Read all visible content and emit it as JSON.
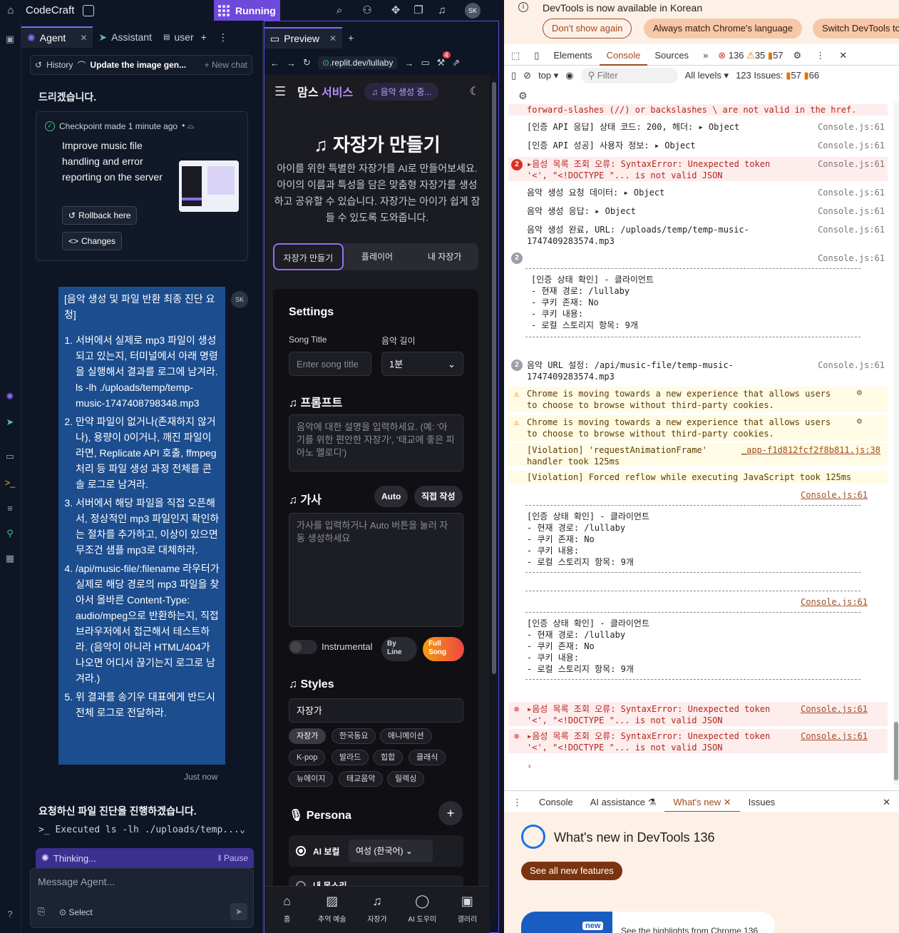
{
  "topbar": {
    "brand": "CodeCraft",
    "run_label": "Running",
    "avatar": "SK",
    "colors": {
      "run": "#6d4ad9"
    }
  },
  "agent": {
    "tabs": [
      {
        "label": "Agent"
      },
      {
        "label": "Assistant"
      },
      {
        "label": "user"
      }
    ],
    "history_label": "History",
    "current_chat": "Update the image gen...",
    "new_chat": "+ New chat",
    "cut_text": "드리겠습니다.",
    "checkpoint": {
      "header": "Checkpoint made 1 minute ago",
      "description": "Improve music file handling and error reporting on the server",
      "rollback": "Rollback here",
      "changes": "Changes"
    },
    "user_message": {
      "title": "[음악 생성 및 파일 반환 최종 진단 요청]",
      "items": [
        "서버에서 실제로 mp3 파일이 생성되고 있는지, 터미널에서 아래 명령을 실행해서 결과를 로그에 남겨라. ls -lh ./uploads/temp/temp-music-1747408798348.mp3",
        "만약 파일이 없거나(존재하지 않거나), 용량이 0이거나, 깨진 파일이라면, Replicate API 호출, ffmpeg 처리 등 파일 생성 과정 전체를 콘솔 로그로 남겨라.",
        "서버에서 해당 파일을 직접 오픈해서, 정상적인 mp3 파일인지 확인하는 절차를 추가하고, 이상이 있으면 무조건 샘플 mp3로 대체하라.",
        "/api/music-file/:filename 라우터가 실제로 해당 경로의 mp3 파일을 찾아서 올바른 Content-Type: audio/mpeg으로 반환하는지, 직접 브라우저에서 접근해서 테스트하라. (음악이 아니라 HTML/404가 나오면 어디서 끊기는지 로그로 남겨라.)",
        "위 결과를 송기우 대표에게 반드시 전체 로그로 전달하라."
      ],
      "avatar": "SK",
      "time": "Just now"
    },
    "reply": "요청하신 파일 진단을 진행하겠습니다.",
    "executed": ">_ Executed ls -lh ./uploads/temp...",
    "thinking": "Thinking...",
    "pause": "Pause",
    "composer": {
      "placeholder": "Message Agent...",
      "select": "Select"
    }
  },
  "preview": {
    "tab_label": "Preview",
    "url": ".replit.dev/lullaby",
    "badge": "4",
    "app": {
      "logo_main": "맘스",
      "logo_accent": "서비스",
      "pill": "음악 생성 중...",
      "hero_title": "자장가 만들기",
      "hero_desc": "아이를 위한 특별한 자장가를 AI로 만들어보세요. 아이의 이름과 특성을 담은 맞춤형 자장가를 생성하고 공유할 수 있습니다. 자장가는 아이가 쉽게 잠들 수 있도록 도와줍니다.",
      "segments": [
        "자장가 만들기",
        "플레이어",
        "내 자장가"
      ],
      "settings": "Settings",
      "song_title_label": "Song Title",
      "song_title_placeholder": "Enter song title",
      "length_label": "음악 길이",
      "length_value": "1분",
      "prompt_h": "프롬프트",
      "prompt_ph": "음악에 대한 설명을 입력하세요. (예: '아기를 위한 편안한 자장가', '태교에 좋은 피아노 멜로디')",
      "lyrics_h": "가사",
      "auto": "Auto",
      "manual": "직접 작성",
      "lyrics_ph": "가사를 입력하거나 Auto 버튼을 눌러 자동 생성하세요",
      "instrumental": "Instrumental",
      "by_line": "By Line",
      "full_song": "Full Song",
      "styles_h": "Styles",
      "style_value": "자장가",
      "chips": [
        "자장가",
        "한국동요",
        "애니메이션",
        "K-pop",
        "발라드",
        "힙합",
        "클래식",
        "뉴에이지",
        "태교음악",
        "릴렉싱"
      ],
      "persona_h": "Persona",
      "ai_vocal": "AI 보컬",
      "voice_select": "여성 (한국어)",
      "my_voice": "내 목소리",
      "nav": [
        "홈",
        "추억 예술",
        "자장가",
        "AI 도우미",
        "갤러리"
      ]
    }
  },
  "devtools": {
    "notice": "DevTools is now available in Korean",
    "btn_dont": "Don't show again",
    "btn_match": "Always match Chrome's language",
    "btn_switch": "Switch DevTools to",
    "tabs": [
      "Elements",
      "Console",
      "Sources"
    ],
    "err_count": "136",
    "warn_count": "35",
    "issue_count": "57",
    "context": "top",
    "filter": "Filter",
    "levels": "All levels",
    "issues": "123 Issues:",
    "issues_a": "57",
    "issues_b": "66",
    "lines": {
      "l0": "forward-slashes (//) or backslashes \\ are not valid in the href.",
      "l1": "[인증 API 응답] 상태 코드: 200, 헤더:  ▸ Object",
      "l2": "[인증 API 성공] 사용자 정보:  ▸ Object",
      "l3": "▸음성 목록 조회 오류: SyntaxError: Unexpected token '<', \"<!DOCTYPE \"... is not valid JSON",
      "l4": "음악 생성 요청 데이터:  ▸ Object",
      "l5": "음악 생성 응답:  ▸ Object",
      "l6": "음악 생성 완료, URL: /uploads/temp/temp-music-1747409283574.mp3",
      "block": "[인증 상태 확인] - 클라이언트\n- 현재 경로: /lullaby\n- 쿠키 존재: No\n- 쿠키 내용:\n- 로컬 스토리지 항목: 9개",
      "l8": "음악 URL 설정: /api/music-file/temp-music-1747409283574.mp3",
      "w1": "Chrome is moving towards a new experience that allows users to choose to browse without third-party cookies.",
      "v1": "[Violation] 'requestAnimationFrame' handler took 125ms",
      "v1src": "_app-f1d812fcf2f8b811.js:38",
      "v2": "[Violation] Forced reflow while executing JavaScript took 125ms",
      "e2": "▸음성 목록 조회 오류: SyntaxError: Unexpected token '<', \"<!DOCTYPE \"... is not valid JSON"
    },
    "src": "Console.js:61",
    "badge2": "2",
    "drawer_tabs": [
      "Console",
      "AI assistance",
      "What's new",
      "Issues"
    ],
    "whats_new_title": "What's new in DevTools 136",
    "see_all": "See all new features",
    "card_tag": "new",
    "card_text": "See the highlights from Chrome 136",
    "colors": {
      "accent": "#a14b1f",
      "error": "#b3261e"
    }
  }
}
